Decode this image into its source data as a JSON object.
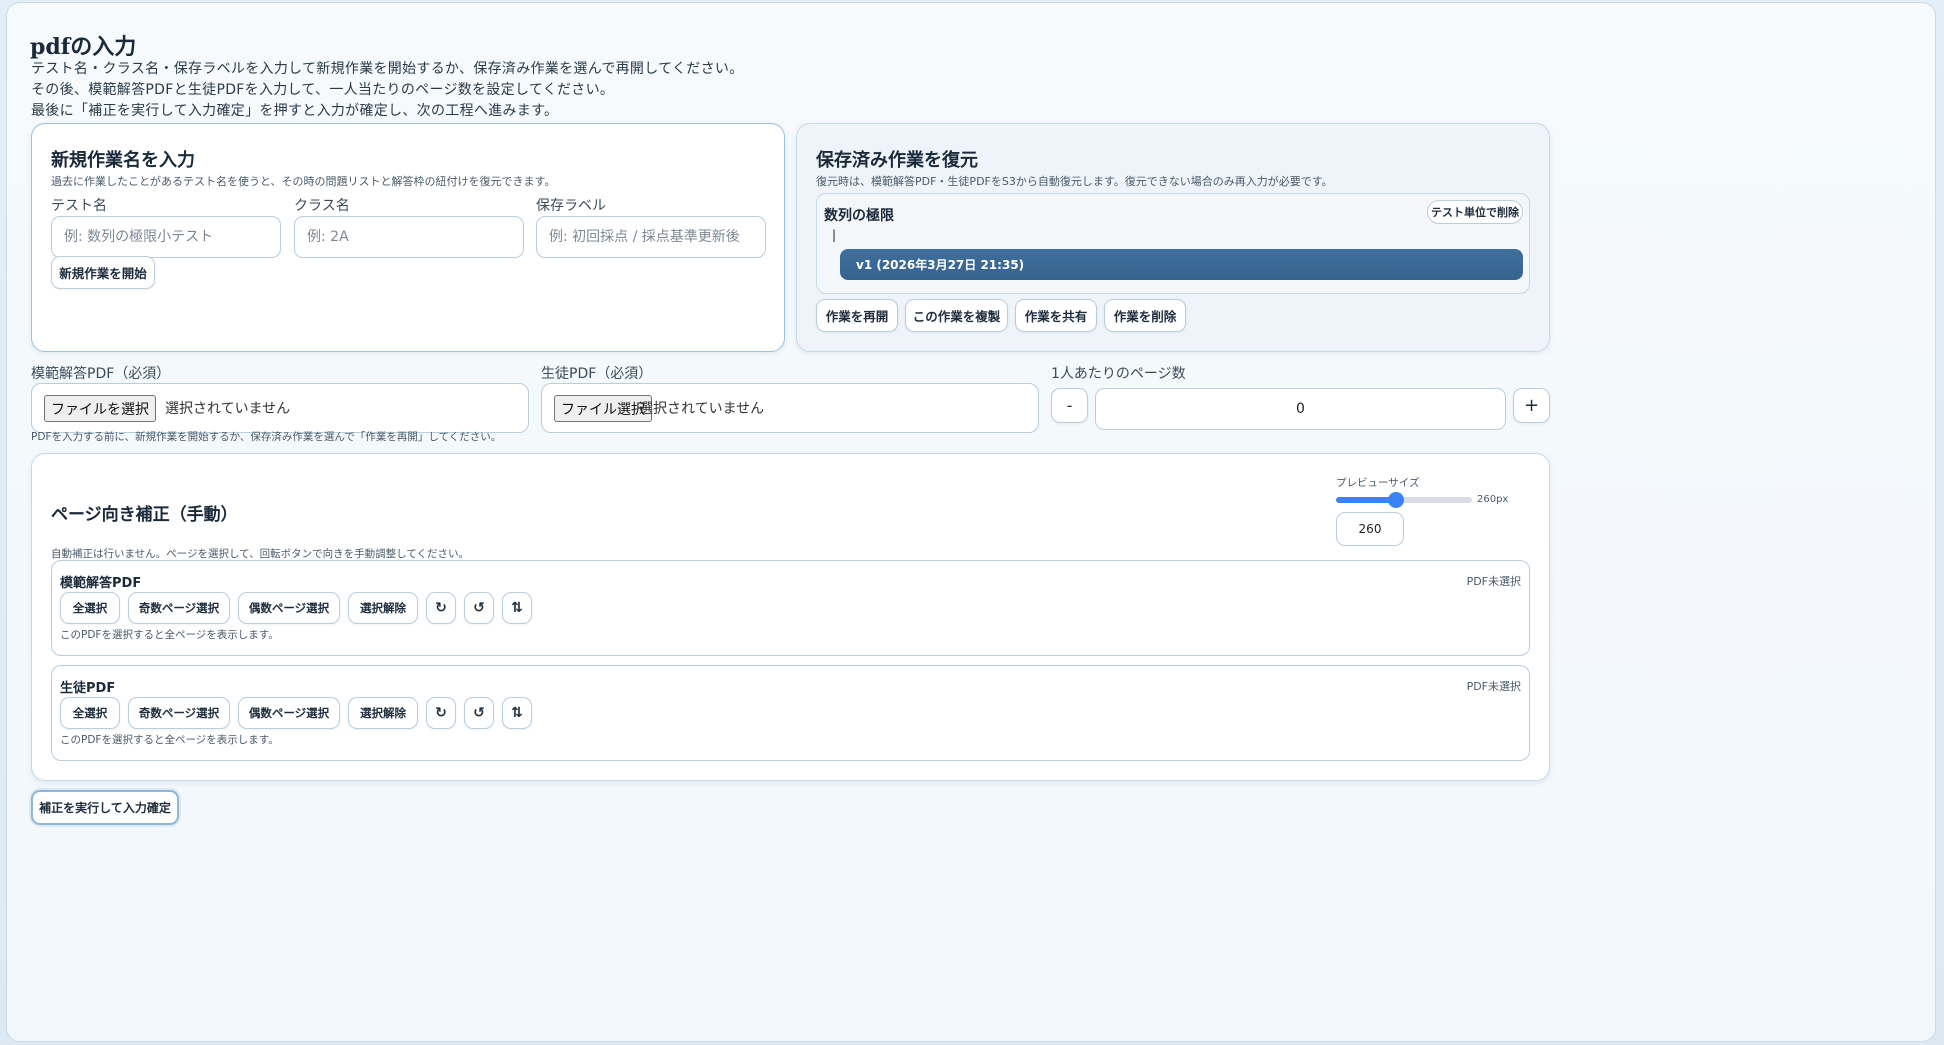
{
  "page": {
    "title": "pdfの入力",
    "intro": [
      "テスト名・クラス名・保存ラベルを入力して新規作業を開始するか、保存済み作業を選んで再開してください。",
      "その後、模範解答PDFと生徒PDFを入力して、一人当たりのページ数を設定してください。",
      "最後に「補正を実行して入力確定」を押すと入力が確定し、次の工程へ進みます。"
    ]
  },
  "new_work": {
    "title": "新規作業名を入力",
    "note": "過去に作業したことがあるテスト名を使うと、その時の問題リストと解答枠の紐付けを復元できます。",
    "test_name_label": "テスト名",
    "test_name_placeholder": "例: 数列の極限小テスト",
    "class_label": "クラス名",
    "class_placeholder": "例: 2A",
    "save_label_label": "保存ラベル",
    "save_label_placeholder": "例: 初回採点 / 採点基準更新後",
    "start_button": "新規作業を開始"
  },
  "restore": {
    "title": "保存済み作業を復元",
    "note": "復元時は、模範解答PDF・生徒PDFをS3から自動復元します。復元できない場合のみ再入力が必要です。",
    "test_group_name": "数列の極限",
    "delete_test_button": "テスト単位で削除",
    "cursor_mark": "|",
    "version_label": "v1 (2026年3月27日 21:35)",
    "resume_button": "作業を再開",
    "duplicate_button": "この作業を複製",
    "share_button": "作業を共有",
    "delete_button": "作業を削除"
  },
  "inputs": {
    "model_pdf_label": "模範解答PDF（必須）",
    "model_pdf_button": "ファイルを選択",
    "model_pdf_status": "選択されていません",
    "student_pdf_label": "生徒PDF（必須）",
    "student_pdf_button": "ファイル選択",
    "student_pdf_status": "選択されていません",
    "pages_label": "1人あたりのページ数",
    "minus": "-",
    "pages_value": "0",
    "plus": "+",
    "hint": "PDFを入力する前に、新規作業を開始するか、保存済み作業を選んで「作業を再開」してください。"
  },
  "orientation": {
    "title": "ページ向き補正（手動）",
    "note": "自動補正は行いません。ページを選択して、回転ボタンで向きを手動調整してください。",
    "preview_label": "プレビューサイズ",
    "preview_fraction": 0.44,
    "preview_px_label": "260px",
    "preview_value": "260",
    "sections": [
      {
        "title": "模範解答PDF",
        "status": "PDF未選択",
        "select_all": "全選択",
        "select_odd": "奇数ページ選択",
        "select_even": "偶数ページ選択",
        "deselect": "選択解除",
        "rotate_cw": "↻",
        "rotate_ccw": "↺",
        "flip": "⇅",
        "note": "このPDFを選択すると全ページを表示します。"
      },
      {
        "title": "生徒PDF",
        "status": "PDF未選択",
        "select_all": "全選択",
        "select_odd": "奇数ページ選択",
        "select_even": "偶数ページ選択",
        "deselect": "選択解除",
        "rotate_cw": "↻",
        "rotate_ccw": "↺",
        "flip": "⇅",
        "note": "このPDFを選択すると全ページを表示します。"
      }
    ]
  },
  "footer": {
    "confirm_button": "補正を実行して入力確定"
  },
  "colors": {
    "accent": "#3b82f6",
    "version_bar": "#3f6f9c",
    "card_border": "#9fc2dc"
  }
}
